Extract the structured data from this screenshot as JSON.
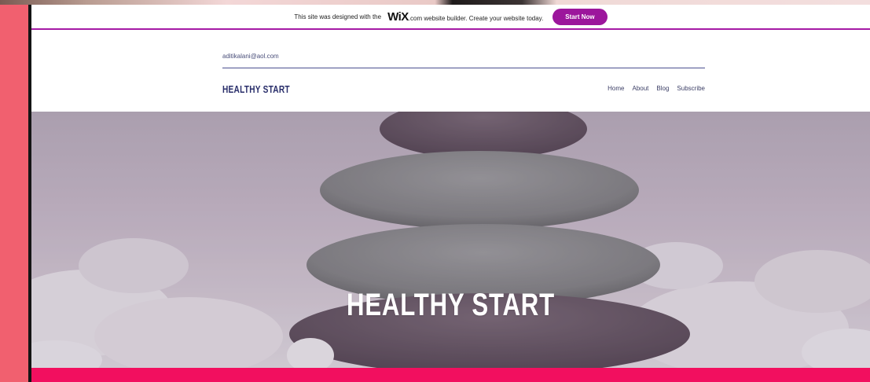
{
  "wix_banner": {
    "text_before_logo": "This site was designed with the",
    "logo": "WiX",
    "text_after_logo": ".com website builder. Create your website today.",
    "button_label": "Start Now"
  },
  "header": {
    "email": "aditikalani@aol.com",
    "brand": "HEALTHY START",
    "nav": [
      "Home",
      "About",
      "Blog",
      "Subscribe"
    ]
  },
  "hero": {
    "title": "HEALTHY START"
  },
  "colors": {
    "accent_purple": "#9c169c",
    "brand_navy": "#2a2f6b",
    "bottom_bar_pink": "#f20f5f",
    "left_band_coral": "#f1606f"
  }
}
